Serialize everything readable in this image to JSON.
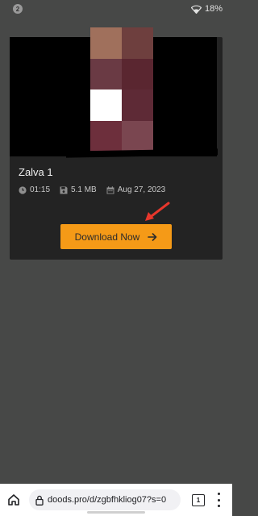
{
  "status_bar": {
    "notification_count": "2",
    "battery": "18%"
  },
  "video": {
    "title": "Zalva 1",
    "duration": "01:15",
    "size": "5.1 MB",
    "date": "Aug 27, 2023",
    "thumbnail_colors": [
      "#a0705c",
      "#6e3f3e",
      "#6a3a44",
      "#5a2630",
      "#ffffff",
      "#5e2a36",
      "#6d2f3c",
      "#7a4650"
    ]
  },
  "download": {
    "button_label": "Download Now",
    "button_color": "#f59a17",
    "arrow_color": "#e8372c"
  },
  "browser": {
    "url": "doods.pro/d/zgbfhkliog07?s=0",
    "tab_count": "1"
  }
}
